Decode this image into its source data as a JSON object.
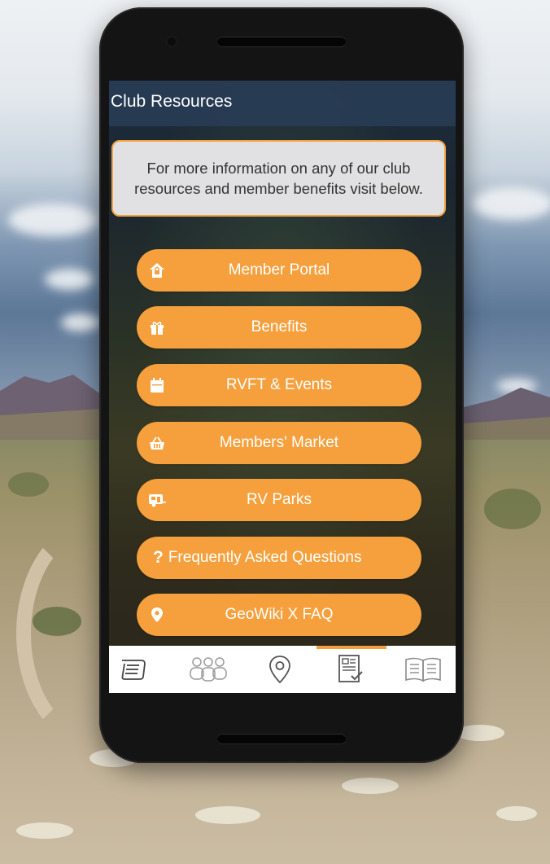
{
  "screen": {
    "title": "Club Resources",
    "info_text": "For more information on any of our club resources and member benefits visit below."
  },
  "buttons": [
    {
      "label": "Member Portal",
      "icon": "house-lock-icon"
    },
    {
      "label": "Benefits",
      "icon": "gift-icon"
    },
    {
      "label": "RVFT & Events",
      "icon": "calendar-icon"
    },
    {
      "label": "Members' Market",
      "icon": "basket-icon"
    },
    {
      "label": "RV Parks",
      "icon": "caravan-icon"
    },
    {
      "label": "Frequently Asked Questions",
      "icon": "question-mark-icon"
    },
    {
      "label": "GeoWiki X FAQ",
      "icon": "map-pin-icon"
    }
  ],
  "tabbar": {
    "tabs": [
      "news-icon",
      "members-icon",
      "location-pin-icon",
      "checklist-document-icon",
      "open-book-icon"
    ],
    "active_index": 3
  },
  "colors": {
    "accent": "#f5a03c",
    "titlebar": "#2c4058",
    "info_background": "#e1e1e3",
    "tabbar_background": "#ffffff",
    "tab_icon": "#9a9a9a"
  }
}
